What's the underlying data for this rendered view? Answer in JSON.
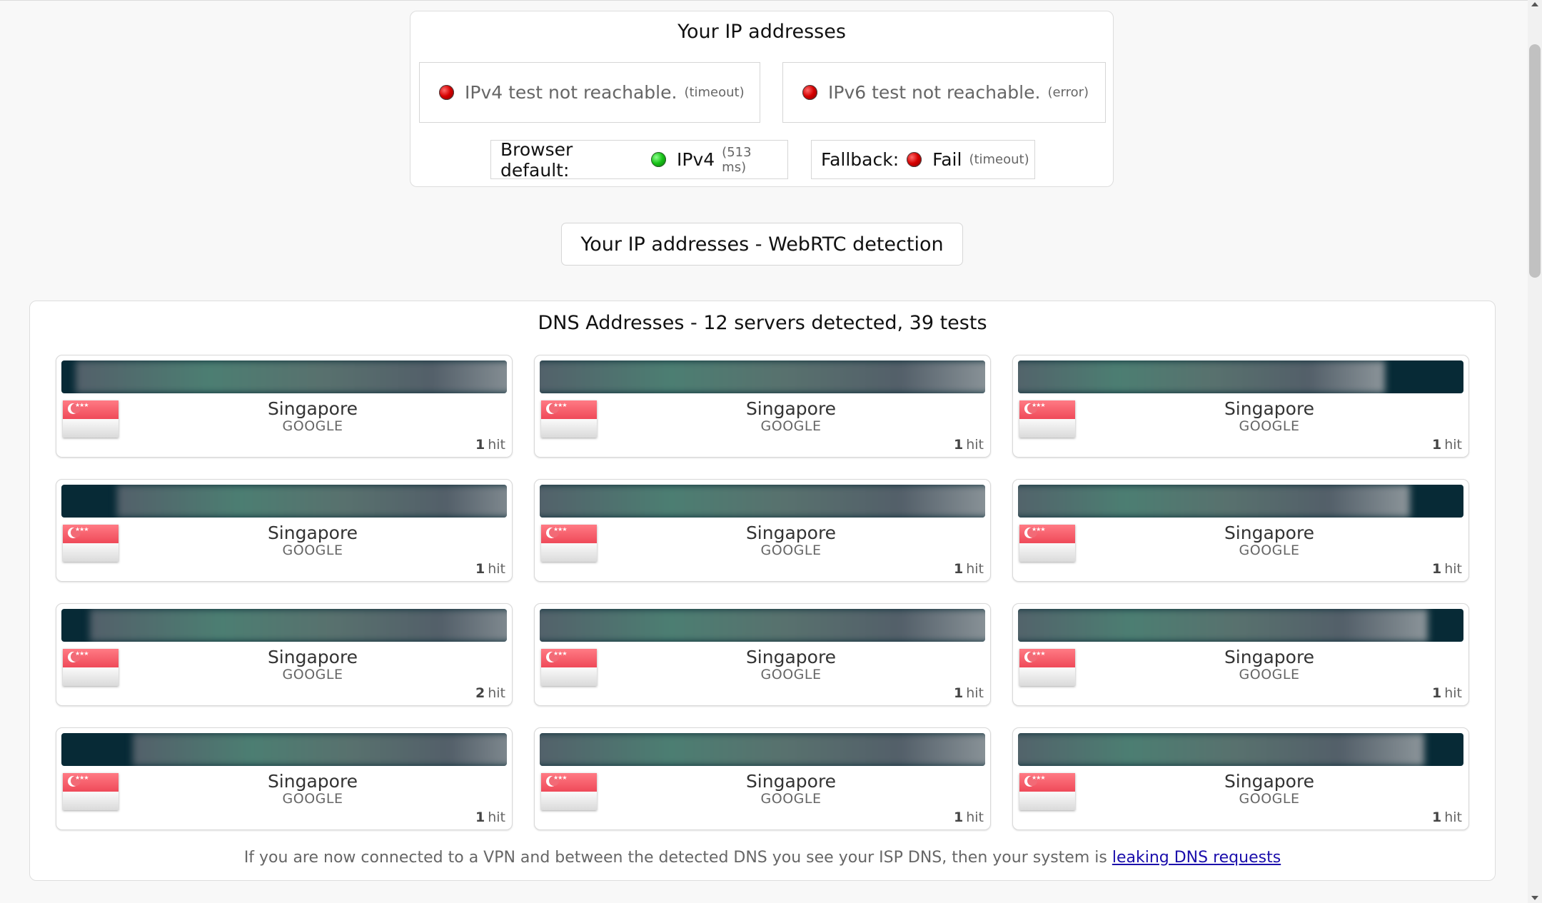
{
  "ip_panel": {
    "title": "Your IP addresses",
    "ipv4": {
      "text": "IPv4 test not reachable.",
      "detail": "(timeout)",
      "status_color": "#d50000"
    },
    "ipv6": {
      "text": "IPv6 test not reachable.",
      "detail": "(error)",
      "status_color": "#d50000"
    },
    "browser_default": {
      "label": "Browser default:",
      "value": "IPv4",
      "detail": "(513 ms)",
      "status_color": "#17c217"
    },
    "fallback": {
      "label": "Fallback:",
      "value": "Fail",
      "detail": "(timeout)",
      "status_color": "#d50000"
    }
  },
  "webrtc_button": {
    "label": "Your IP addresses - WebRTC detection"
  },
  "dns": {
    "title": "DNS Addresses - 12 servers detected, 39 tests",
    "servers": [
      {
        "country": "Singapore",
        "isp": "GOOGLE",
        "hits": "1",
        "hit_label": "hit"
      },
      {
        "country": "Singapore",
        "isp": "GOOGLE",
        "hits": "1",
        "hit_label": "hit"
      },
      {
        "country": "Singapore",
        "isp": "GOOGLE",
        "hits": "1",
        "hit_label": "hit"
      },
      {
        "country": "Singapore",
        "isp": "GOOGLE",
        "hits": "1",
        "hit_label": "hit"
      },
      {
        "country": "Singapore",
        "isp": "GOOGLE",
        "hits": "1",
        "hit_label": "hit"
      },
      {
        "country": "Singapore",
        "isp": "GOOGLE",
        "hits": "1",
        "hit_label": "hit"
      },
      {
        "country": "Singapore",
        "isp": "GOOGLE",
        "hits": "2",
        "hit_label": "hit"
      },
      {
        "country": "Singapore",
        "isp": "GOOGLE",
        "hits": "1",
        "hit_label": "hit"
      },
      {
        "country": "Singapore",
        "isp": "GOOGLE",
        "hits": "1",
        "hit_label": "hit"
      },
      {
        "country": "Singapore",
        "isp": "GOOGLE",
        "hits": "1",
        "hit_label": "hit"
      },
      {
        "country": "Singapore",
        "isp": "GOOGLE",
        "hits": "1",
        "hit_label": "hit"
      },
      {
        "country": "Singapore",
        "isp": "GOOGLE",
        "hits": "1",
        "hit_label": "hit"
      }
    ],
    "footer_text": "If you are now connected to a VPN and between the detected DNS you see your ISP DNS, then your system is",
    "footer_link": "leaking DNS requests"
  }
}
